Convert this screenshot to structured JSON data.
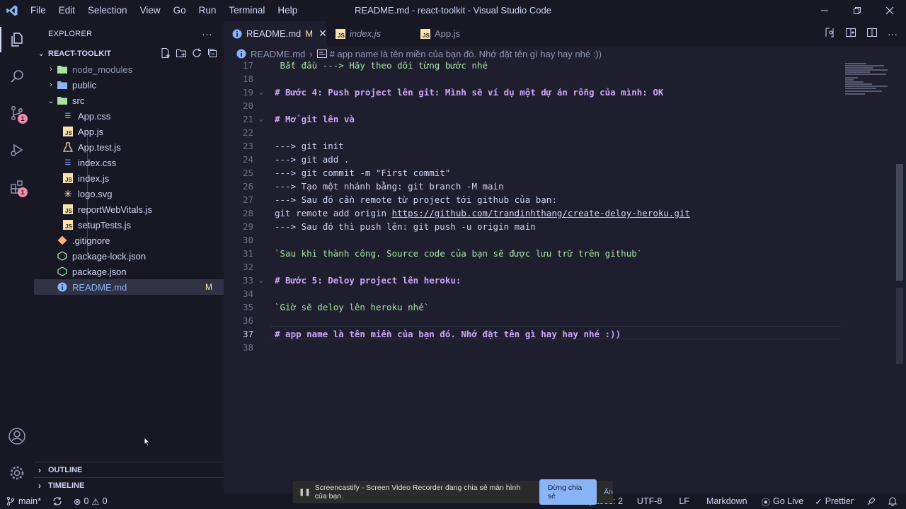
{
  "window": {
    "title": "README.md - react-toolkit - Visual Studio Code",
    "menu": [
      "File",
      "Edit",
      "Selection",
      "View",
      "Go",
      "Run",
      "Terminal",
      "Help"
    ]
  },
  "activity_bar": {
    "items": [
      "explorer-icon",
      "search-icon",
      "source-control-icon",
      "run-debug-icon",
      "extensions-icon"
    ],
    "source_control_badge": "1",
    "extensions_badge": "1",
    "bottom": [
      "accounts-icon",
      "manage-gear-icon"
    ]
  },
  "sidebar": {
    "header": "EXPLORER",
    "more": "···",
    "root": "REACT-TOOLKIT",
    "tree": [
      {
        "label": "node_modules",
        "type": "folder",
        "icon": "folder-node-icon",
        "color": "#a6e3a1"
      },
      {
        "label": "public",
        "type": "folder",
        "icon": "folder-public-icon",
        "color": "#89b4fa"
      },
      {
        "label": "src",
        "type": "folder-open",
        "icon": "folder-src-icon",
        "color": "#a6e3a1"
      },
      {
        "label": "App.css",
        "type": "file",
        "icon": "css-icon",
        "color": "#89b4fa"
      },
      {
        "label": "App.js",
        "type": "file",
        "icon": "js-icon",
        "color": "#f9e2af"
      },
      {
        "label": "App.test.js",
        "type": "file",
        "icon": "test-icon",
        "color": "#f9e2af"
      },
      {
        "label": "index.css",
        "type": "file",
        "icon": "css-icon",
        "color": "#89b4fa"
      },
      {
        "label": "index.js",
        "type": "file",
        "icon": "js-icon",
        "color": "#f9e2af"
      },
      {
        "label": "logo.svg",
        "type": "file",
        "icon": "svg-icon",
        "color": "#f9e2af"
      },
      {
        "label": "reportWebVitals.js",
        "type": "file",
        "icon": "js-icon",
        "color": "#f9e2af"
      },
      {
        "label": "setupTests.js",
        "type": "file",
        "icon": "js-icon",
        "color": "#f9e2af"
      },
      {
        "label": ".gitignore",
        "type": "file",
        "icon": "git-icon",
        "color": "#fab387"
      },
      {
        "label": "package-lock.json",
        "type": "file",
        "icon": "npm-icon",
        "color": "#a6e3a1"
      },
      {
        "label": "package.json",
        "type": "file",
        "icon": "npm-icon",
        "color": "#a6e3a1"
      },
      {
        "label": "README.md",
        "type": "file",
        "icon": "info-icon",
        "color": "#89b4fa",
        "modified": "M"
      }
    ],
    "outline": "OUTLINE",
    "timeline": "TIMELINE"
  },
  "tabs": [
    {
      "label": "README.md",
      "modified": "M",
      "active": true,
      "close": "✕"
    },
    {
      "label": "index.js",
      "active": false
    },
    {
      "label": "App.js",
      "active": false
    }
  ],
  "breadcrumb": {
    "file": "README.md",
    "symbol": "# app name là tên miền của bạn đó. Nhớ đặt tên gì hay hay nhé :))"
  },
  "editor": {
    "lines": [
      {
        "n": "17",
        "text": " Bắt đầu ---> Hãy theo dõi từng bước nhé",
        "kind": "green"
      },
      {
        "n": "18",
        "text": "",
        "kind": "plain"
      },
      {
        "n": "19",
        "text": "# Bước 4: Push project lên git: Mình sẽ ví dụ một dự án rỗng của mình: OK",
        "kind": "head",
        "fold": "⌄"
      },
      {
        "n": "20",
        "text": "",
        "kind": "plain"
      },
      {
        "n": "21",
        "text": "# Mở git lên và",
        "kind": "head",
        "fold": "⌄"
      },
      {
        "n": "22",
        "text": "",
        "kind": "plain"
      },
      {
        "n": "23",
        "text": "---> git init",
        "kind": "plain"
      },
      {
        "n": "24",
        "text": "---> git add .",
        "kind": "plain"
      },
      {
        "n": "25",
        "text": "---> git commit -m \"First commit\"",
        "kind": "plain"
      },
      {
        "n": "26",
        "text": "---> Tạo một nhánh bằng: git branch -M main",
        "kind": "plain"
      },
      {
        "n": "27",
        "text": "---> Sau đó cần remote từ project tới github của bạn:",
        "kind": "plain"
      },
      {
        "n": "28",
        "prefix": "git remote add origin ",
        "link": "https://github.com/trandinhthang/create-deloy-heroku.git",
        "kind": "link"
      },
      {
        "n": "29",
        "text": "---> Sau đó thì push lên: git push -u origin main",
        "kind": "plain"
      },
      {
        "n": "30",
        "text": "",
        "kind": "plain"
      },
      {
        "n": "31",
        "text": "`Sau khi thành công. Source code của bạn sẽ được lưu trữ trên github`",
        "kind": "green"
      },
      {
        "n": "32",
        "text": "",
        "kind": "plain"
      },
      {
        "n": "33",
        "text": "# Bước 5: Deloy project lên heroku:",
        "kind": "head",
        "fold": "⌄"
      },
      {
        "n": "34",
        "text": "",
        "kind": "plain"
      },
      {
        "n": "35",
        "text": "`Giờ sẽ deloy lên heroku nhé`",
        "kind": "green"
      },
      {
        "n": "36",
        "text": "",
        "kind": "plain"
      },
      {
        "n": "37",
        "text": "# app name là tên miền của bạn đó. Nhớ đặt tên gì hay hay nhé :))",
        "kind": "head",
        "current": true
      },
      {
        "n": "38",
        "text": "",
        "kind": "plain"
      }
    ]
  },
  "statusbar": {
    "branch": "main*",
    "errors": "0",
    "warnings": "0",
    "spaces": "Spaces: 2",
    "encoding": "UTF-8",
    "eol": "LF",
    "language": "Markdown",
    "golive": "Go Live",
    "prettier": "Prettier"
  },
  "notification": {
    "text": "Screencastify - Screen Video Recorder đang chia sẻ màn hình của bạn.",
    "stop": "Dừng chia sẻ",
    "hide": "Ẩn"
  },
  "colors": {
    "heading": "#cba6f7",
    "string": "#a6e3a1",
    "modified": "#f9e2af",
    "badge": "#f38ba8"
  }
}
